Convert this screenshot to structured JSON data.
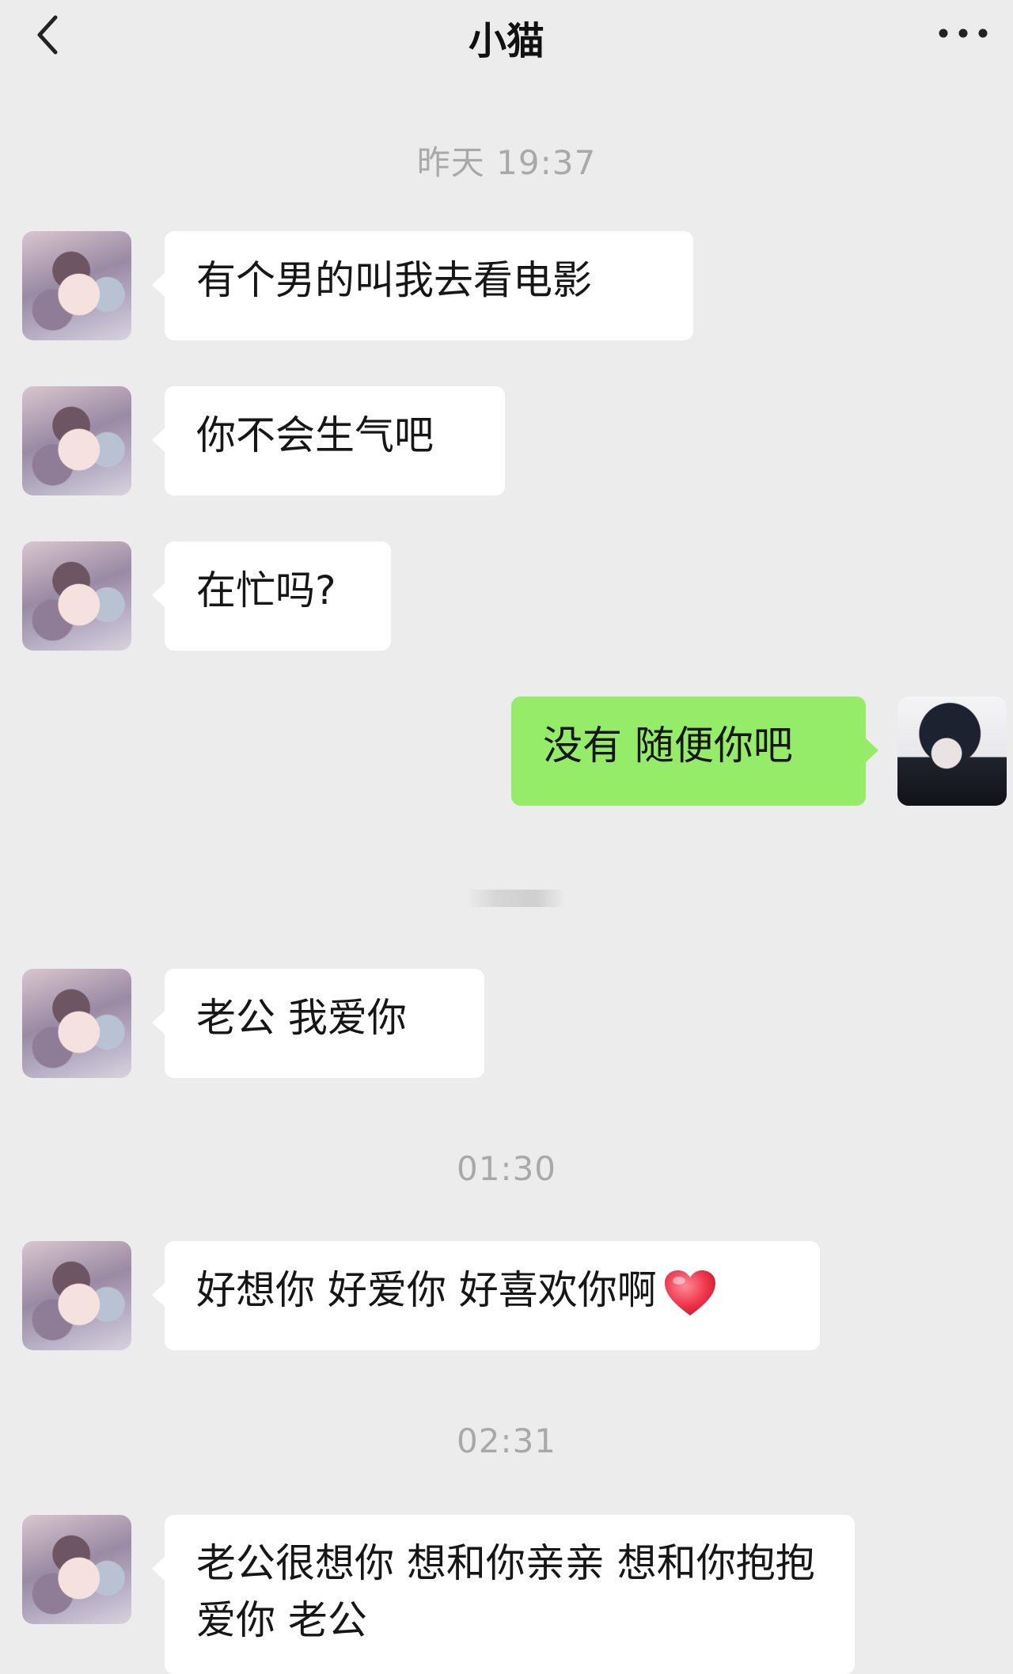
{
  "header": {
    "title": "小猫",
    "back_icon": "chevron-left-icon",
    "more_icon": "more-icon"
  },
  "timestamps": {
    "t1": "昨天 19:37",
    "t2": "01:30",
    "t3": "02:31"
  },
  "messages": [
    {
      "from": "her",
      "text": "有个男的叫我去看电影"
    },
    {
      "from": "her",
      "text": "你不会生气吧"
    },
    {
      "from": "her",
      "text": "在忙吗?"
    },
    {
      "from": "me",
      "text": "没有 随便你吧"
    },
    {
      "from": "her",
      "text": "老公  我爱你"
    },
    {
      "from": "her",
      "text": "好想你 好爱你 好喜欢你啊",
      "emoji": "heart-icon"
    },
    {
      "from": "her",
      "text": "老公很想你 想和你亲亲 想和你抱抱 爱你 老公"
    }
  ],
  "colors": {
    "background": "#ececec",
    "incoming_bubble": "#ffffff",
    "outgoing_bubble": "#95ec69",
    "timestamp": "#a9a9a9"
  }
}
